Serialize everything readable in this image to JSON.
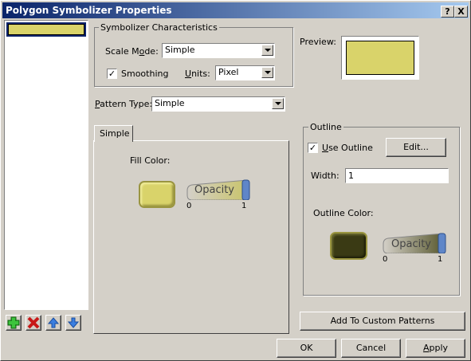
{
  "window": {
    "title": "Polygon Symbolizer Properties",
    "help_label": "?",
    "close_label": "X"
  },
  "symbolizer": {
    "legend": "Symbolizer Characteristics",
    "scale_mode_label": "Scale Mode:",
    "scale_mode_value": "Simple",
    "smoothing_label": "Smoothing",
    "smoothing_checked": true,
    "units_label": "Units:",
    "units_value": "Pixel",
    "preview_label": "Preview:",
    "fill_color": "#d9d36a"
  },
  "pattern": {
    "type_label": "Pattern Type:",
    "type_value": "Simple"
  },
  "tabs": [
    {
      "label": "Simple"
    }
  ],
  "fill": {
    "label": "Fill Color:",
    "color": "#d9d36a",
    "opacity_label": "Opacity",
    "opacity_min": "0",
    "opacity_max": "1",
    "opacity_value": 1
  },
  "outline": {
    "legend": "Outline",
    "use_outline_label": "Use Outline",
    "use_outline_checked": true,
    "edit_label": "Edit...",
    "width_label": "Width:",
    "width_value": "1",
    "color_label": "Outline Color:",
    "color": "#3a3a14",
    "opacity_label": "Opacity",
    "opacity_min": "0",
    "opacity_max": "1",
    "opacity_value": 1
  },
  "add_custom_label": "Add To Custom Patterns",
  "footer": {
    "ok_label": "OK",
    "cancel_label": "Cancel",
    "apply_label": "Apply"
  },
  "list_toolbar": [
    "add-icon",
    "remove-icon",
    "move-up-icon",
    "move-down-icon"
  ],
  "colors": {
    "accent": "#0a246a",
    "face": "#d4d0c8"
  }
}
